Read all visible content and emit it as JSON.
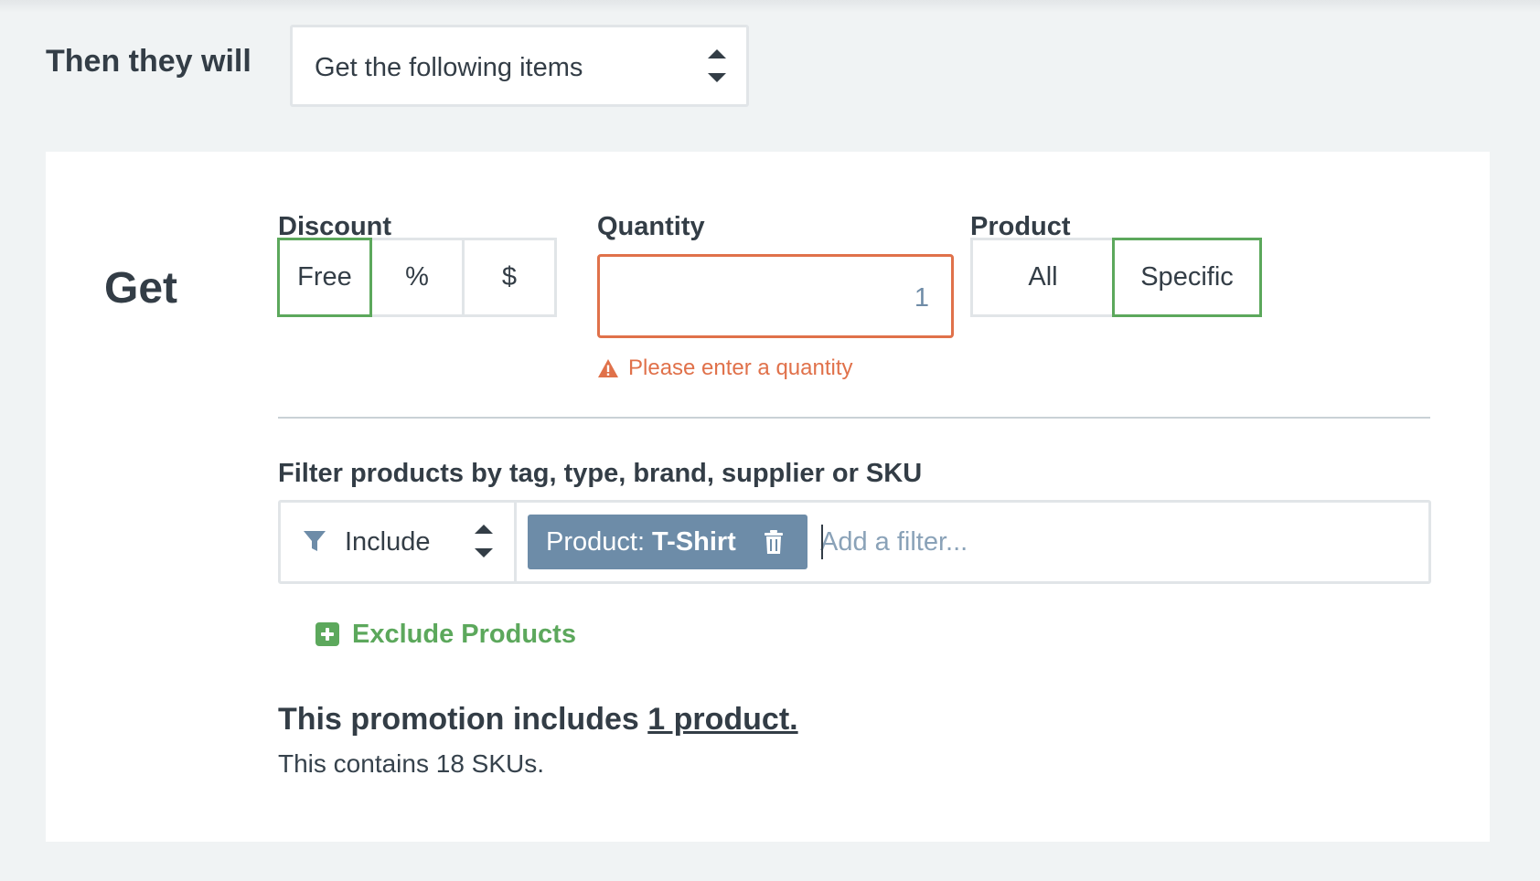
{
  "rule": {
    "label": "Then they will",
    "select_value": "Get the following items"
  },
  "get_section": {
    "title": "Get",
    "discount": {
      "label": "Discount",
      "options": [
        "Free",
        "%",
        "$"
      ],
      "selected": "Free"
    },
    "quantity": {
      "label": "Quantity",
      "value": "1",
      "error": "Please enter a quantity"
    },
    "product": {
      "label": "Product",
      "options": [
        "All",
        "Specific"
      ],
      "selected": "Specific"
    },
    "filter": {
      "label": "Filter products by tag, type, brand, supplier or SKU",
      "mode": "Include",
      "tag_key": "Product:",
      "tag_value": "T-Shirt",
      "placeholder": "Add a filter..."
    },
    "exclude_label": "Exclude Products",
    "summary_prefix": "This promotion includes",
    "summary_link": "1 product.",
    "sku_text": "This contains 18 SKUs."
  },
  "colors": {
    "active_green": "#5ca85c",
    "error_orange": "#e0714a",
    "tag_blue": "#6d8ca8"
  }
}
